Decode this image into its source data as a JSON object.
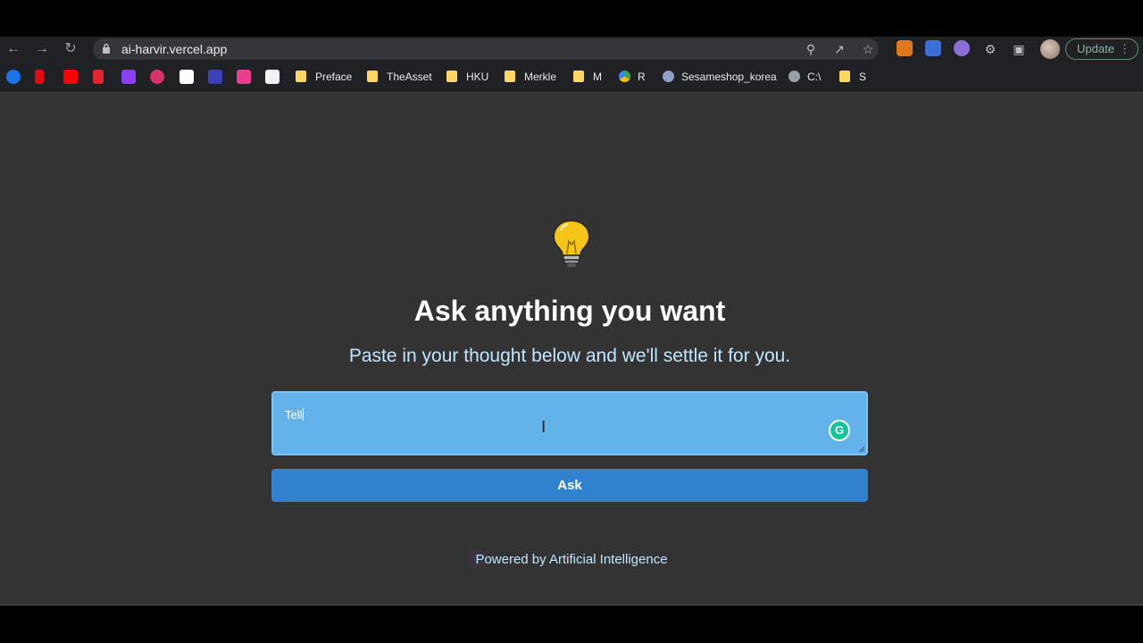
{
  "browser": {
    "url": "ai-harvir.vercel.app",
    "update_label": "Update",
    "bookmarks": [
      "Preface",
      "TheAsset",
      "HKU",
      "Merkle",
      "M",
      "R",
      "Sesameshop_korea",
      "C:\\",
      "S"
    ]
  },
  "page": {
    "title": "Ask anything you want",
    "subtitle": "Paste in your thought below and we'll settle it for you.",
    "input_value": "Tell",
    "ask_label": "Ask",
    "footer": "Powered by Artificial Intelligence",
    "grammarly_letter": "G"
  },
  "colors": {
    "page_bg": "#333333",
    "input_bg": "#64b2ea",
    "button_bg": "#3182ce",
    "subtitle": "#bfe6ff",
    "bulb": "#f5c518"
  },
  "icons": [
    "back-arrow-icon",
    "forward-arrow-icon",
    "reload-icon",
    "lock-icon",
    "zoom-icon",
    "share-icon",
    "star-icon",
    "metamask-icon",
    "extension-icon",
    "puzzle-icon",
    "sidepanel-icon",
    "menu-dots-icon",
    "lightbulb-icon",
    "grammarly-icon",
    "text-cursor-icon"
  ]
}
